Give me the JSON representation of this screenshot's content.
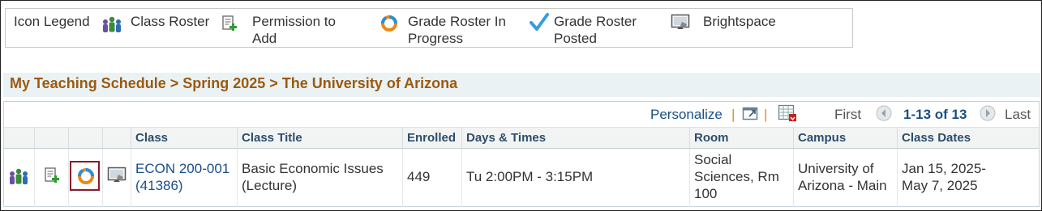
{
  "legend": {
    "title": "Icon Legend",
    "items": [
      {
        "icon": "class-roster-icon",
        "label": "Class Roster"
      },
      {
        "icon": "permission-to-add-icon",
        "label_line1": "Permission to",
        "label_line2": "Add"
      },
      {
        "icon": "grade-roster-in-progress-icon",
        "label_line1": "Grade Roster In",
        "label_line2": "Progress"
      },
      {
        "icon": "grade-roster-posted-icon",
        "label_line1": "Grade Roster",
        "label_line2": "Posted"
      },
      {
        "icon": "brightspace-icon",
        "label": "Brightspace"
      }
    ]
  },
  "breadcrumb": "My Teaching Schedule > Spring 2025 > The University of Arizona",
  "grid_nav": {
    "personalize": "Personalize",
    "separator": "|",
    "first": "First",
    "range": "1-13 of 13",
    "last": "Last"
  },
  "columns": [
    "Class",
    "Class Title",
    "Enrolled",
    "Days & Times",
    "Room",
    "Campus",
    "Class Dates"
  ],
  "rows": [
    {
      "class_line1": "ECON 200-001",
      "class_line2": "(41386)",
      "title_line1": "Basic Economic Issues",
      "title_line2": "(Lecture)",
      "enrolled": "449",
      "days_times": "Tu 2:00PM - 3:15PM",
      "room_line1": "Social",
      "room_line2": "Sciences, Rm",
      "room_line3": "100",
      "campus_line1": "University of",
      "campus_line2": "Arizona - Main",
      "dates_line1": "Jan 15, 2025-",
      "dates_line2": "May 7, 2025"
    }
  ],
  "colors": {
    "breadcrumb": "#9a5a10",
    "link": "#1a4f86",
    "highlight_border": "#8b1a2b"
  }
}
